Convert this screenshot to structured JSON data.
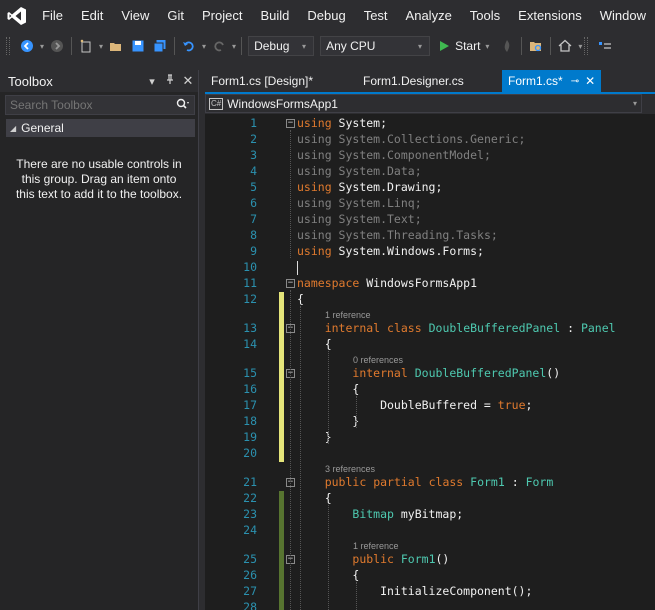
{
  "menu": {
    "items": [
      "File",
      "Edit",
      "View",
      "Git",
      "Project",
      "Build",
      "Debug",
      "Test",
      "Analyze",
      "Tools",
      "Extensions",
      "Window"
    ]
  },
  "toolbar": {
    "configuration": "Debug",
    "platform": "Any CPU",
    "start_label": "Start"
  },
  "toolbox": {
    "title": "Toolbox",
    "search_placeholder": "Search Toolbox",
    "group_label": "General",
    "empty_message": "There are no usable controls in this group. Drag an item onto this text to add it to the toolbox."
  },
  "tabs": [
    {
      "label": "Form1.cs [Design]*",
      "active": false
    },
    {
      "label": "Form1.Designer.cs",
      "active": false
    },
    {
      "label": "Form1.cs*",
      "active": true
    }
  ],
  "navbar": {
    "project": "WindowsFormsApp1"
  },
  "editor": {
    "lens": {
      "ref1": "1 reference",
      "ref0": "0 references",
      "ref3": "3 references",
      "ref1b": "1 reference"
    },
    "lines": [
      {
        "n": "1",
        "parts": [
          {
            "c": "kwo",
            "t": "using"
          },
          {
            "c": "id",
            "t": " System;"
          }
        ]
      },
      {
        "n": "2",
        "parts": [
          {
            "c": "kw2 dim",
            "t": "using"
          },
          {
            "c": "dim",
            "t": " System.Collections.Generic;"
          }
        ]
      },
      {
        "n": "3",
        "parts": [
          {
            "c": "kw2 dim",
            "t": "using"
          },
          {
            "c": "dim",
            "t": " System.ComponentModel;"
          }
        ]
      },
      {
        "n": "4",
        "parts": [
          {
            "c": "kw2 dim",
            "t": "using"
          },
          {
            "c": "dim",
            "t": " System.Data;"
          }
        ]
      },
      {
        "n": "5",
        "parts": [
          {
            "c": "kwo",
            "t": "using"
          },
          {
            "c": "id",
            "t": " System.Drawing;"
          }
        ]
      },
      {
        "n": "6",
        "parts": [
          {
            "c": "kw2 dim",
            "t": "using"
          },
          {
            "c": "dim",
            "t": " System.Linq;"
          }
        ]
      },
      {
        "n": "7",
        "parts": [
          {
            "c": "kw2 dim",
            "t": "using"
          },
          {
            "c": "dim",
            "t": " System.Text;"
          }
        ]
      },
      {
        "n": "8",
        "parts": [
          {
            "c": "kw2 dim",
            "t": "using"
          },
          {
            "c": "dim",
            "t": " System.Threading.Tasks;"
          }
        ]
      },
      {
        "n": "9",
        "parts": [
          {
            "c": "kwo",
            "t": "using"
          },
          {
            "c": "id",
            "t": " System.Windows.Forms;"
          }
        ]
      },
      {
        "n": "10",
        "parts": []
      },
      {
        "n": "11",
        "parts": [
          {
            "c": "kwo",
            "t": "namespace"
          },
          {
            "c": "id",
            "t": " WindowsFormsApp1"
          }
        ]
      },
      {
        "n": "12",
        "parts": [
          {
            "c": "id",
            "t": "{"
          }
        ]
      },
      {
        "n": "13",
        "parts": [
          {
            "c": "id",
            "t": "    "
          },
          {
            "c": "kwo",
            "t": "internal"
          },
          {
            "c": "id",
            "t": " "
          },
          {
            "c": "kwo",
            "t": "class"
          },
          {
            "c": "id",
            "t": " "
          },
          {
            "c": "ty",
            "t": "DoubleBufferedPanel"
          },
          {
            "c": "id",
            "t": " : "
          },
          {
            "c": "ty",
            "t": "Panel"
          }
        ]
      },
      {
        "n": "14",
        "parts": [
          {
            "c": "id",
            "t": "    {"
          }
        ]
      },
      {
        "n": "15",
        "parts": [
          {
            "c": "id",
            "t": "        "
          },
          {
            "c": "kwo",
            "t": "internal"
          },
          {
            "c": "id",
            "t": " "
          },
          {
            "c": "ty",
            "t": "DoubleBufferedPanel"
          },
          {
            "c": "id",
            "t": "()"
          }
        ]
      },
      {
        "n": "16",
        "parts": [
          {
            "c": "id",
            "t": "        {"
          }
        ]
      },
      {
        "n": "17",
        "parts": [
          {
            "c": "id",
            "t": "            DoubleBuffered = "
          },
          {
            "c": "kwo",
            "t": "true"
          },
          {
            "c": "id",
            "t": ";"
          }
        ]
      },
      {
        "n": "18",
        "parts": [
          {
            "c": "id",
            "t": "        }"
          }
        ]
      },
      {
        "n": "19",
        "parts": [
          {
            "c": "id",
            "t": "    }"
          }
        ]
      },
      {
        "n": "20",
        "parts": []
      },
      {
        "n": "21",
        "parts": [
          {
            "c": "id",
            "t": "    "
          },
          {
            "c": "kwo",
            "t": "public"
          },
          {
            "c": "id",
            "t": " "
          },
          {
            "c": "kwo",
            "t": "partial"
          },
          {
            "c": "id",
            "t": " "
          },
          {
            "c": "kwo",
            "t": "class"
          },
          {
            "c": "id",
            "t": " "
          },
          {
            "c": "ty",
            "t": "Form1"
          },
          {
            "c": "id",
            "t": " : "
          },
          {
            "c": "ty",
            "t": "Form"
          }
        ]
      },
      {
        "n": "22",
        "parts": [
          {
            "c": "id",
            "t": "    {"
          }
        ]
      },
      {
        "n": "23",
        "parts": [
          {
            "c": "id",
            "t": "        "
          },
          {
            "c": "ty",
            "t": "Bitmap"
          },
          {
            "c": "id",
            "t": " myBitmap;"
          }
        ]
      },
      {
        "n": "24",
        "parts": []
      },
      {
        "n": "25",
        "parts": [
          {
            "c": "id",
            "t": "        "
          },
          {
            "c": "kwo",
            "t": "public"
          },
          {
            "c": "id",
            "t": " "
          },
          {
            "c": "ty",
            "t": "Form1"
          },
          {
            "c": "id",
            "t": "()"
          }
        ]
      },
      {
        "n": "26",
        "parts": [
          {
            "c": "id",
            "t": "        {"
          }
        ]
      },
      {
        "n": "27",
        "parts": [
          {
            "c": "id",
            "t": "            InitializeComponent();"
          }
        ]
      },
      {
        "n": "28",
        "parts": []
      }
    ]
  }
}
